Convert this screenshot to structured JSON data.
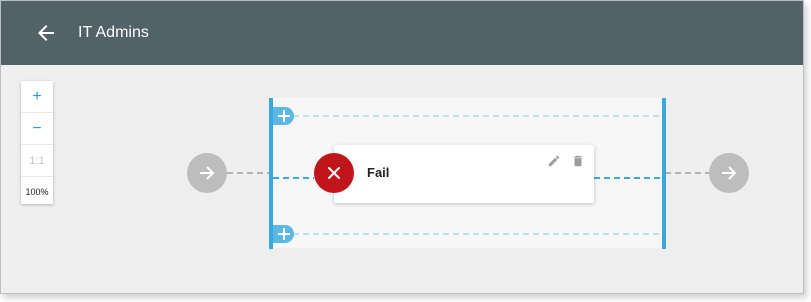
{
  "header": {
    "title": "IT Admins",
    "back_icon": "arrow-left-icon"
  },
  "zoom": {
    "zoom_in_label": "+",
    "zoom_out_label": "−",
    "reset_label": "1:1",
    "level": "100%"
  },
  "flow": {
    "step": {
      "label": "Fail",
      "status_icon": "close-icon",
      "status_color": "#c0151b",
      "actions": [
        "edit-icon",
        "trash-icon"
      ]
    },
    "entry_icon": "arrow-right-icon",
    "exit_icon": "arrow-right-icon",
    "add_icon": "plus-icon"
  },
  "colors": {
    "topbar": "#536269",
    "accent": "#3aa8dc",
    "connector_gray": "#b3b3b3"
  }
}
